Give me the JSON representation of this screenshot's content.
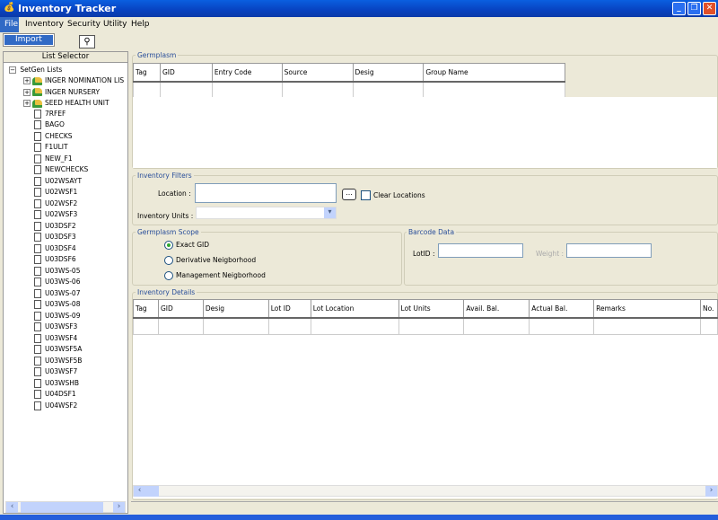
{
  "window": {
    "title": "Inventory Tracker"
  },
  "menu": {
    "file": "File",
    "inventory": "Inventory",
    "security": "Security",
    "utility": "Utility",
    "help": "Help",
    "file_items": [
      "Import"
    ]
  },
  "toolbar": {
    "search_icon": "binoculars-icon"
  },
  "list_selector": {
    "title": "List Selector",
    "root": "SetGen Lists",
    "folders": [
      "INGER NOMINATION LIS",
      "INGER NURSERY",
      "SEED HEALTH UNIT"
    ],
    "lists": [
      "7RFEF",
      "BAGO",
      "CHECKS",
      "F1ULIT",
      "NEW_F1",
      "NEWCHECKS",
      "U02WSAYT",
      "U02WSF1",
      "U02WSF2",
      "U02WSF3",
      "U03DSF2",
      "U03DSF3",
      "U03DSF4",
      "U03DSF6",
      "U03WS-05",
      "U03WS-06",
      "U03WS-07",
      "U03WS-08",
      "U03WS-09",
      "U03WSF3",
      "U03WSF4",
      "U03WSF5A",
      "U03WSF5B",
      "U03WSF7",
      "U03WSHB",
      "U04DSF1",
      "U04WSF2"
    ]
  },
  "germplasm": {
    "title": "Germplasm",
    "columns": [
      "Tag",
      "GID",
      "Entry Code",
      "Source",
      "Desig",
      "Group Name"
    ]
  },
  "filters": {
    "title": "Inventory Filters",
    "location_label": "Location :",
    "location_value": "",
    "browse_label": "...",
    "clear_label": "Clear Locations",
    "units_label": "Inventory Units :",
    "units_value": ""
  },
  "scope": {
    "title": "Germplasm Scope",
    "options": [
      "Exact GID",
      "Derivative Neigborhood",
      "Management Neigborhood"
    ],
    "selected": "Exact GID"
  },
  "barcode": {
    "title": "Barcode Data",
    "lotid_label": "LotID :",
    "weight_label": "Weight :",
    "lotid_value": "",
    "weight_value": ""
  },
  "details": {
    "title": "Inventory Details",
    "columns": [
      "Tag",
      "GID",
      "Desig",
      "Lot ID",
      "Lot Location",
      "Lot Units",
      "Avail. Bal.",
      "Actual Bal.",
      "Remarks",
      "No."
    ]
  }
}
